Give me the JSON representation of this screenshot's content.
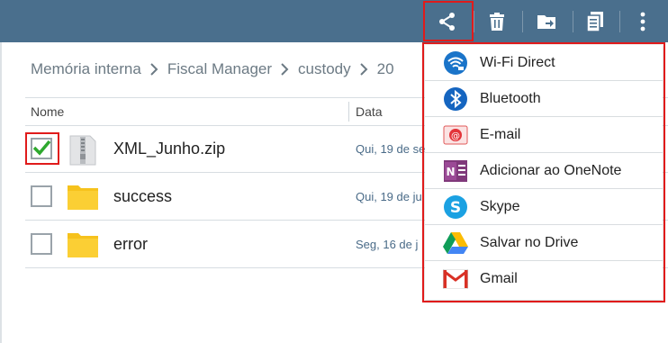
{
  "toolbar": {
    "icons": [
      "share-icon",
      "trash-icon",
      "move-folder-icon",
      "copy-icon",
      "more-vert-icon"
    ]
  },
  "breadcrumb": {
    "items": [
      "Memória interna",
      "Fiscal Manager",
      "custody",
      "20"
    ]
  },
  "table": {
    "columns": [
      "Nome",
      "Data"
    ],
    "rows": [
      {
        "name": "XML_Junho.zip",
        "date": "Qui, 19 de se",
        "checked": true,
        "icon": "zip-file-icon"
      },
      {
        "name": "success",
        "date": "Qui, 19 de ju",
        "checked": false,
        "icon": "folder-icon"
      },
      {
        "name": "error",
        "date": "Seg, 16 de j",
        "checked": false,
        "icon": "folder-icon"
      }
    ]
  },
  "share_menu": {
    "items": [
      {
        "label": "Wi-Fi Direct",
        "icon": "wifi-direct-icon"
      },
      {
        "label": "Bluetooth",
        "icon": "bluetooth-icon"
      },
      {
        "label": "E-mail",
        "icon": "email-icon"
      },
      {
        "label": "Adicionar ao OneNote",
        "icon": "onenote-icon"
      },
      {
        "label": "Skype",
        "icon": "skype-icon"
      },
      {
        "label": "Salvar no Drive",
        "icon": "drive-icon"
      },
      {
        "label": "Gmail",
        "icon": "gmail-icon"
      }
    ]
  },
  "colors": {
    "toolbar": "#4a6f8d",
    "highlight": "#e01b1b",
    "check": "#2ea82e",
    "folder": "#f6c21c"
  }
}
